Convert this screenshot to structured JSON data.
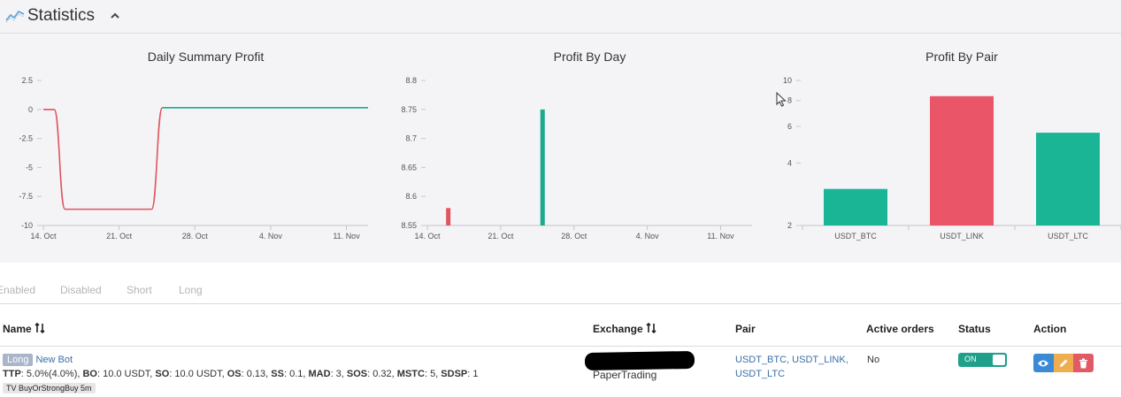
{
  "header": {
    "title": "Statistics",
    "icon": "chart-line-icon",
    "toggle_icon": "chevron-up-icon"
  },
  "chart_data": [
    {
      "type": "line",
      "title": "Daily Summary Profit",
      "x_ticks": [
        "14. Oct",
        "21. Oct",
        "28. Oct",
        "4. Nov",
        "11. Nov"
      ],
      "y_ticks": [
        "2.5",
        "0",
        "-2.5",
        "-5",
        "-7.5",
        "-10"
      ],
      "ylim": [
        -10,
        2.5
      ],
      "xlim": [
        "14. Oct",
        "13. Nov"
      ],
      "series": [
        {
          "color": "#e0545f",
          "points": [
            [
              "14. Oct",
              0
            ],
            [
              "15. Oct",
              0
            ],
            [
              "16. Oct",
              -8.6
            ],
            [
              "24. Oct",
              -8.6
            ],
            [
              "25. Oct",
              0.15
            ]
          ]
        },
        {
          "color": "#1aaa8d",
          "points": [
            [
              "25. Oct",
              0.15
            ],
            [
              "13. Nov",
              0.15
            ]
          ]
        }
      ]
    },
    {
      "type": "bar",
      "title": "Profit By Day",
      "x_ticks": [
        "14. Oct",
        "21. Oct",
        "28. Oct",
        "4. Nov",
        "11. Nov"
      ],
      "y_ticks": [
        "8.8",
        "8.75",
        "8.7",
        "8.65",
        "8.6",
        "8.55"
      ],
      "ylim": [
        8.55,
        8.8
      ],
      "xlim": [
        "14. Oct",
        "14. Nov"
      ],
      "bars": [
        {
          "x": "16. Oct",
          "value": 8.58,
          "color": "#e0545f"
        },
        {
          "x": "25. Oct",
          "value": 8.75,
          "color": "#1aaa8d"
        }
      ]
    },
    {
      "type": "bar",
      "title": "Profit By Pair",
      "categories": [
        "USDT_BTC",
        "USDT_LINK",
        "USDT_LTC"
      ],
      "values": [
        3.0,
        8.4,
        5.6
      ],
      "colors": [
        "#1ab594",
        "#ea5567",
        "#1ab594"
      ],
      "y_ticks": [
        "10",
        "8",
        "6",
        "4",
        "2"
      ],
      "y_scale": "log",
      "ylim": [
        2,
        10
      ]
    }
  ],
  "filters": [
    {
      "label": "Enabled"
    },
    {
      "label": "Disabled"
    },
    {
      "label": "Short"
    },
    {
      "label": "Long"
    }
  ],
  "table": {
    "columns": {
      "name": "Name",
      "exchange": "Exchange",
      "pair": "Pair",
      "active_orders": "Active orders",
      "status": "Status",
      "action": "Action"
    },
    "row": {
      "direction": "Long",
      "bot_name": "New Bot",
      "params": [
        {
          "key": "TTP",
          "value": "5.0%(4.0%)"
        },
        {
          "key": "BO",
          "value": "10.0 USDT"
        },
        {
          "key": "SO",
          "value": "10.0 USDT"
        },
        {
          "key": "OS",
          "value": "0.13"
        },
        {
          "key": "SS",
          "value": "0.1"
        },
        {
          "key": "MAD",
          "value": "3"
        },
        {
          "key": "SOS",
          "value": "0.32"
        },
        {
          "key": "MSTC",
          "value": "5"
        },
        {
          "key": "SDSP",
          "value": "1"
        }
      ],
      "strategy": "TV BuyOrStrongBuy 5m",
      "exchange_type": "PaperTrading",
      "pairs_line1": "USDT_BTC, USDT_LINK,",
      "pairs_line2": "USDT_LTC",
      "active_orders": "No",
      "status_label": "ON",
      "actions": [
        "eye-icon",
        "pencil-icon",
        "trash-icon"
      ]
    }
  }
}
